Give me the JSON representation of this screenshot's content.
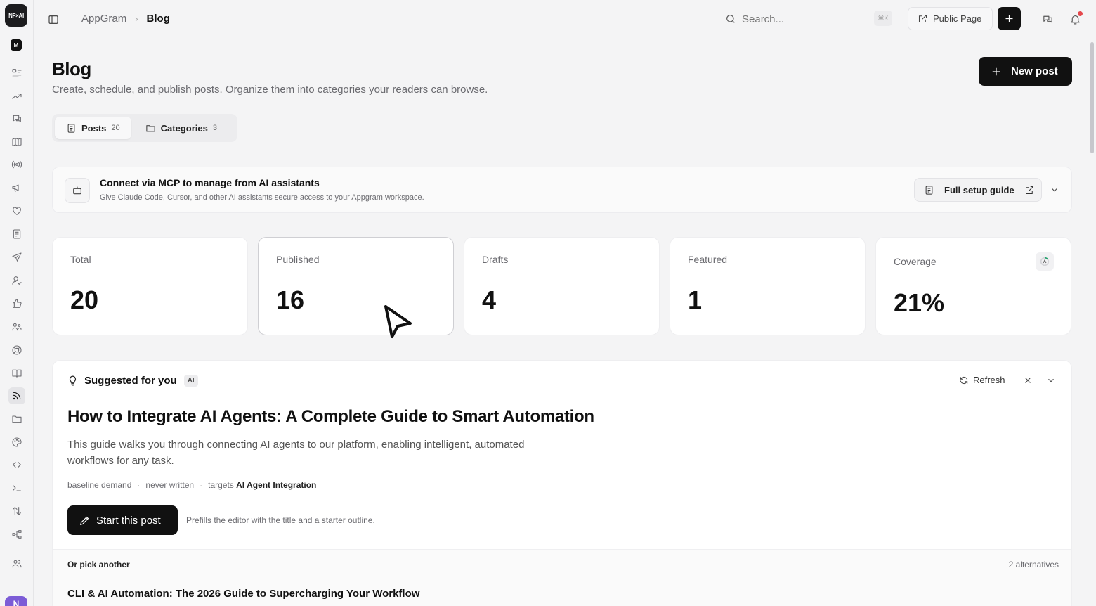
{
  "app": {
    "logo_text": "NF×AI",
    "workspace_initial": "M",
    "user_initial": "N"
  },
  "rail": {
    "items": [
      {
        "name": "tasks-icon"
      },
      {
        "name": "trending-icon"
      },
      {
        "name": "feedback-icon"
      },
      {
        "name": "roadmap-icon"
      },
      {
        "name": "broadcast-icon"
      },
      {
        "name": "megaphone-icon"
      },
      {
        "name": "heart-icon"
      },
      {
        "name": "form-icon"
      },
      {
        "name": "send-icon"
      },
      {
        "name": "user-check-icon"
      },
      {
        "name": "thumbs-up-icon"
      },
      {
        "name": "team-icon"
      },
      {
        "name": "help-icon"
      },
      {
        "name": "book-icon"
      },
      {
        "name": "rss-icon",
        "active": true
      },
      {
        "name": "folder-icon"
      },
      {
        "name": "palette-icon"
      },
      {
        "name": "code-icon"
      },
      {
        "name": "terminal-icon"
      },
      {
        "name": "sort-icon"
      },
      {
        "name": "workflow-icon"
      },
      {
        "name": "users-icon"
      }
    ]
  },
  "topbar": {
    "breadcrumb": [
      "AppGram",
      "Blog"
    ],
    "search_placeholder": "Search...",
    "shortcut": "⌘K",
    "public_page_label": "Public Page"
  },
  "page": {
    "title": "Blog",
    "subtitle": "Create, schedule, and publish posts. Organize them into categories your readers can browse.",
    "new_post_label": "New post"
  },
  "tabs": [
    {
      "label": "Posts",
      "count": "20",
      "active": true
    },
    {
      "label": "Categories",
      "count": "3",
      "active": false
    }
  ],
  "mcp": {
    "title": "Connect via MCP to manage from AI assistants",
    "description": "Give Claude Code, Cursor, and other AI assistants secure access to your Appgram workspace.",
    "guide_label": "Full setup guide"
  },
  "stats": [
    {
      "label": "Total",
      "value": "20"
    },
    {
      "label": "Published",
      "value": "16"
    },
    {
      "label": "Drafts",
      "value": "4"
    },
    {
      "label": "Featured",
      "value": "1"
    },
    {
      "label": "Coverage",
      "value": "21%"
    }
  ],
  "suggestion": {
    "heading": "Suggested for you",
    "badge": "AI",
    "refresh_label": "Refresh",
    "title": "How to Integrate AI Agents: A Complete Guide to Smart Automation",
    "description": "This guide walks you through connecting AI agents to our platform, enabling intelligent, automated workflows for any task.",
    "meta_demand": "baseline demand",
    "meta_status": "never written",
    "meta_targets_prefix": "targets",
    "meta_targets": "AI Agent Integration",
    "start_label": "Start this post",
    "start_hint": "Prefills the editor with the title and a starter outline.",
    "alternatives_heading": "Or pick another",
    "alternatives_count": "2 alternatives",
    "alternatives": [
      {
        "title": "CLI & AI Automation: The 2026 Guide to Supercharging Your Workflow"
      }
    ]
  },
  "colors": {
    "accent": "#111111",
    "background": "#f4f4f5",
    "card": "#ffffff",
    "notification": "#e5484d",
    "avatar": "#7c5cd6"
  }
}
